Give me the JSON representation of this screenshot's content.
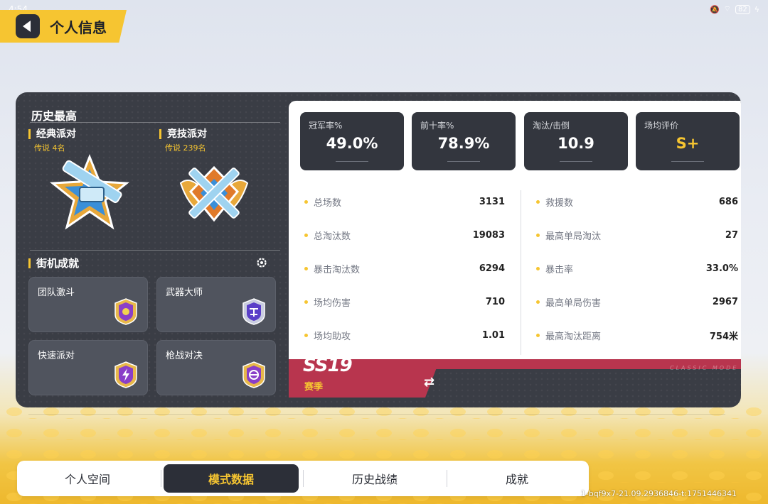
{
  "status": {
    "time": "4:54",
    "battery": "82"
  },
  "header": {
    "title": "个人信息"
  },
  "history": {
    "title": "历史最高",
    "modes": [
      {
        "name": "经典派对",
        "rank": "传说 4名"
      },
      {
        "name": "竞技派对",
        "rank": "传说 239名"
      }
    ]
  },
  "arcade": {
    "title": "街机成就",
    "cards": [
      {
        "label": "团队激斗",
        "icon": "team-fight-badge-icon"
      },
      {
        "label": "武器大师",
        "icon": "weapon-master-badge-icon"
      },
      {
        "label": "快速派对",
        "icon": "lightning-badge-icon"
      },
      {
        "label": "枪战对决",
        "icon": "gun-duel-badge-icon"
      }
    ]
  },
  "tiles": [
    {
      "label": "冠军率%",
      "value": "49.0%"
    },
    {
      "label": "前十率%",
      "value": "78.9%"
    },
    {
      "label": "淘汰/击倒",
      "value": "10.9"
    },
    {
      "label": "场均评价",
      "value": "S+"
    }
  ],
  "stats_left": [
    {
      "label": "总场数",
      "value": "3131"
    },
    {
      "label": "总淘汰数",
      "value": "19083"
    },
    {
      "label": "暴击淘汰数",
      "value": "6294"
    },
    {
      "label": "场均伤害",
      "value": "710"
    },
    {
      "label": "场均助攻",
      "value": "1.01"
    }
  ],
  "stats_right": [
    {
      "label": "救援数",
      "value": "686"
    },
    {
      "label": "最高单局淘汰",
      "value": "27"
    },
    {
      "label": "暴击率",
      "value": "33.0%"
    },
    {
      "label": "最高单局伤害",
      "value": "2967"
    },
    {
      "label": "最高淘汰距离",
      "value": "754米"
    }
  ],
  "season": {
    "code": "SS19",
    "label": "赛季",
    "mode_text": "CLASSIC MODE"
  },
  "tabs": [
    {
      "label": "个人空间",
      "active": false
    },
    {
      "label": "模式数据",
      "active": true
    },
    {
      "label": "历史战绩",
      "active": false
    },
    {
      "label": "成就",
      "active": false
    }
  ],
  "build_id": "1-bqf9x7-21.09.2936846-t:1751446341",
  "colors": {
    "accent": "#f6c531",
    "panel": "#3a3d45",
    "season": "#b8354e"
  }
}
